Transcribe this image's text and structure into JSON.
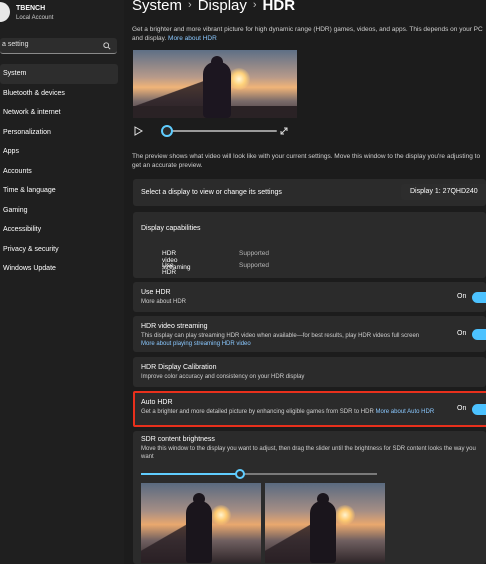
{
  "account": {
    "name": "TBENCH",
    "type": "Local Account"
  },
  "search": {
    "value": "a setting"
  },
  "nav": [
    {
      "label": "System"
    },
    {
      "label": "Bluetooth & devices"
    },
    {
      "label": "Network & internet"
    },
    {
      "label": "Personalization"
    },
    {
      "label": "Apps"
    },
    {
      "label": "Accounts"
    },
    {
      "label": "Time & language"
    },
    {
      "label": "Gaming"
    },
    {
      "label": "Accessibility"
    },
    {
      "label": "Privacy & security"
    },
    {
      "label": "Windows Update"
    }
  ],
  "breadcrumb": {
    "part1": "System",
    "part2": "Display",
    "current": "HDR",
    "sep": "›"
  },
  "intro": {
    "text": "Get a brighter and more vibrant picture for high dynamic range (HDR) games, videos, and apps. This depends on your PC and display.",
    "link": "More about HDR"
  },
  "preview_desc": "The preview shows what video will look like with your current settings. Move this window to the display you're adjusting to get an accurate preview.",
  "display_select": {
    "label": "Select a display to view or change its settings",
    "value": "Display 1: 27QHD240"
  },
  "capabilities": {
    "title": "Display capabilities",
    "rows": [
      {
        "label": "HDR video streaming",
        "value": "Supported"
      },
      {
        "label": "Use HDR",
        "value": "Supported"
      }
    ]
  },
  "use_hdr": {
    "title": "Use HDR",
    "link": "More about HDR",
    "state": "On"
  },
  "hdr_streaming": {
    "title": "HDR video streaming",
    "desc": "This display can play streaming HDR video when available—for best results, play HDR videos full screen",
    "link": "More about playing streaming HDR video",
    "state": "On"
  },
  "calibration": {
    "title": "HDR Display Calibration",
    "desc": "Improve color accuracy and consistency on your HDR display"
  },
  "auto_hdr": {
    "title": "Auto HDR",
    "desc": "Get a brighter and more detailed picture by enhancing eligible games from SDR to HDR",
    "link": "More about Auto HDR",
    "state": "On"
  },
  "sdr": {
    "title": "SDR content brightness",
    "desc": "Move this window to the display you want to adjust, then drag the slider until the brightness for SDR content looks the way you want",
    "level": 0.42
  },
  "accent": "#4cc2ff",
  "highlight_color": "#e8301c"
}
